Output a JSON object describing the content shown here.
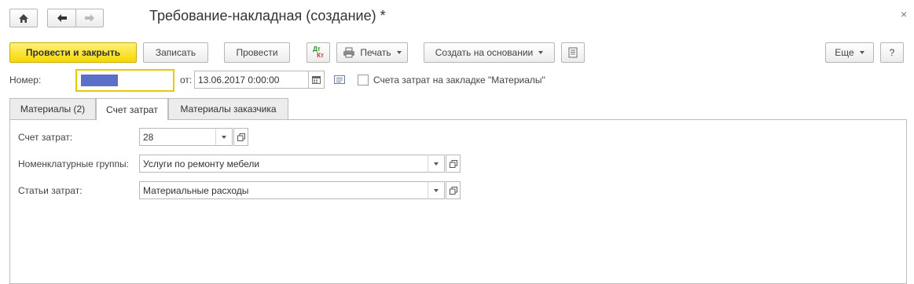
{
  "window": {
    "title": "Требование-накладная (создание) *",
    "close_glyph": "×"
  },
  "nav": {
    "home_icon": "home-icon",
    "back_icon": "arrow-left-icon",
    "forward_icon": "arrow-right-icon"
  },
  "toolbar": {
    "post_and_close": "Провести и закрыть",
    "save": "Записать",
    "post": "Провести",
    "dt_kt_top": "Дт",
    "dt_kt_bottom": "Кт",
    "print": "Печать",
    "create_based_on": "Создать на основании",
    "more": "Еще",
    "help": "?"
  },
  "header": {
    "number_label": "Номер:",
    "number_value": "",
    "date_label": "от:",
    "date_value": "13.06.2017  0:00:00",
    "cost_accounts_checkbox_label": "Счета затрат на закладке \"Материалы\"",
    "cost_accounts_checked": false
  },
  "tabs": [
    {
      "label": "Материалы (2)",
      "active": false
    },
    {
      "label": "Счет затрат",
      "active": true
    },
    {
      "label": "Материалы заказчика",
      "active": false
    }
  ],
  "cost_tab": {
    "cost_account_label": "Счет затрат:",
    "cost_account_value": "28",
    "nomenclature_groups_label": "Номенклатурные группы:",
    "nomenclature_groups_value": "Услуги по ремонту мебели",
    "cost_items_label": "Статьи затрат:",
    "cost_items_value": "Материальные расходы"
  },
  "colors": {
    "primary_button": "#f5d800",
    "number_field_border": "#e8c800",
    "number_selection": "#5b6fc9"
  }
}
